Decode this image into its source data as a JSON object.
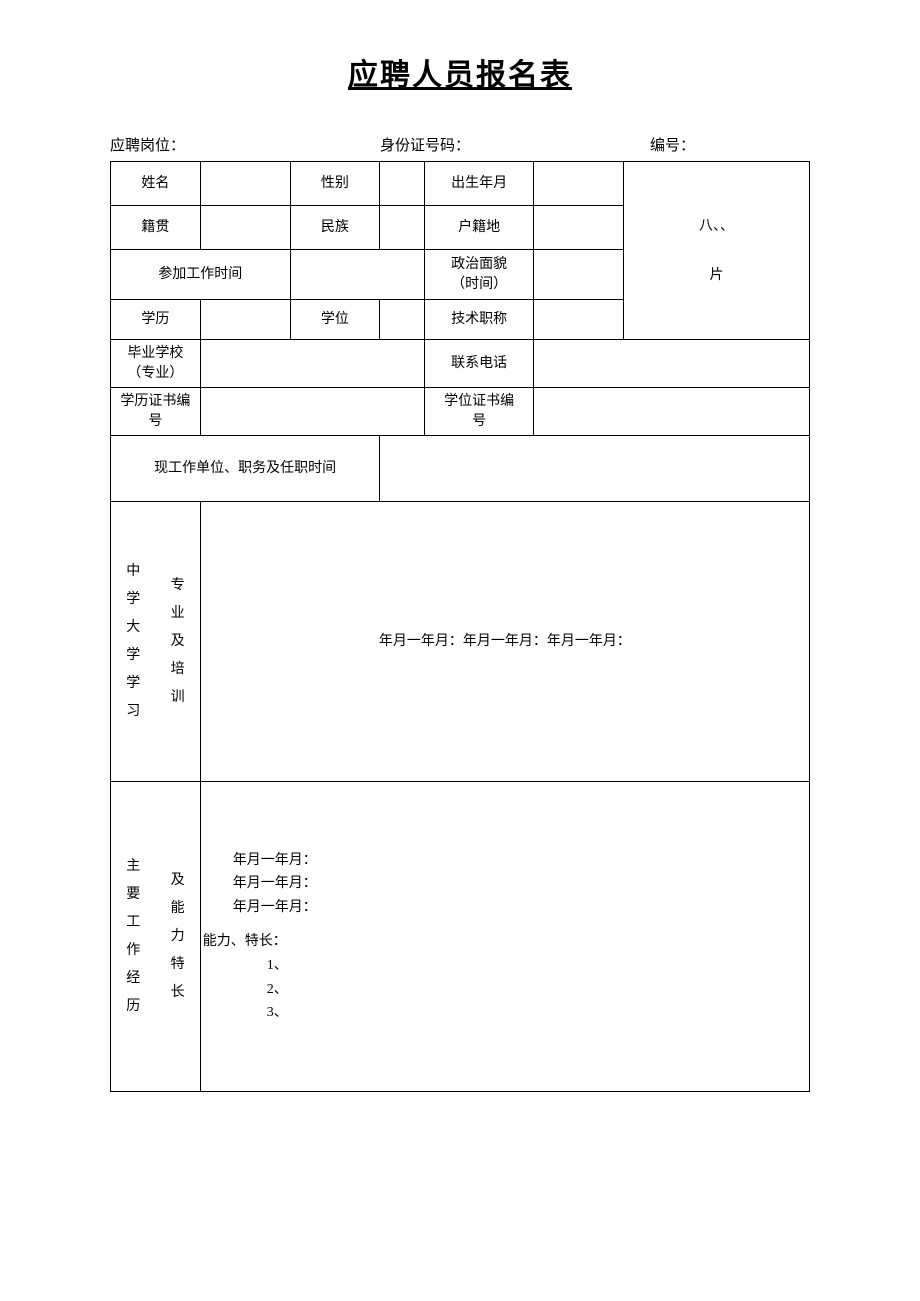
{
  "title": "应聘人员报名表",
  "header": {
    "position_label": "应聘岗位：",
    "id_label": "身份证号码：",
    "serial_label": "编号："
  },
  "labels": {
    "name": "姓名",
    "gender": "性别",
    "birth": "出生年月",
    "photo_line1": "八、、",
    "photo_line2": "片",
    "native_place": "籍贯",
    "ethnicity": "民族",
    "residence": "户籍地",
    "work_start": "参加工作时间",
    "political": "政治面貌\n（时间）",
    "education": "学历",
    "degree": "学位",
    "tech_title": "技术职称",
    "grad_school": "毕业学校\n（专业）",
    "phone": "联系电话",
    "edu_cert_no": "学历证书编\n号",
    "deg_cert_no": "学位证书编\n号",
    "current_work": "现工作单位、职务及任职时间",
    "study_col1": "中学大学学习",
    "study_col2": "专业及培训",
    "study_content": "年月一年月：年月一年月：年月一年月：",
    "work_col1": "主要工作经历",
    "work_col2": "及能力特长",
    "work_lines": {
      "l1": "年月一年月：",
      "l2": "年月一年月：",
      "l3": "年月一年月：",
      "abil": "能力、特长：",
      "n1": "1、",
      "n2": "2、",
      "n3": "3、"
    }
  }
}
